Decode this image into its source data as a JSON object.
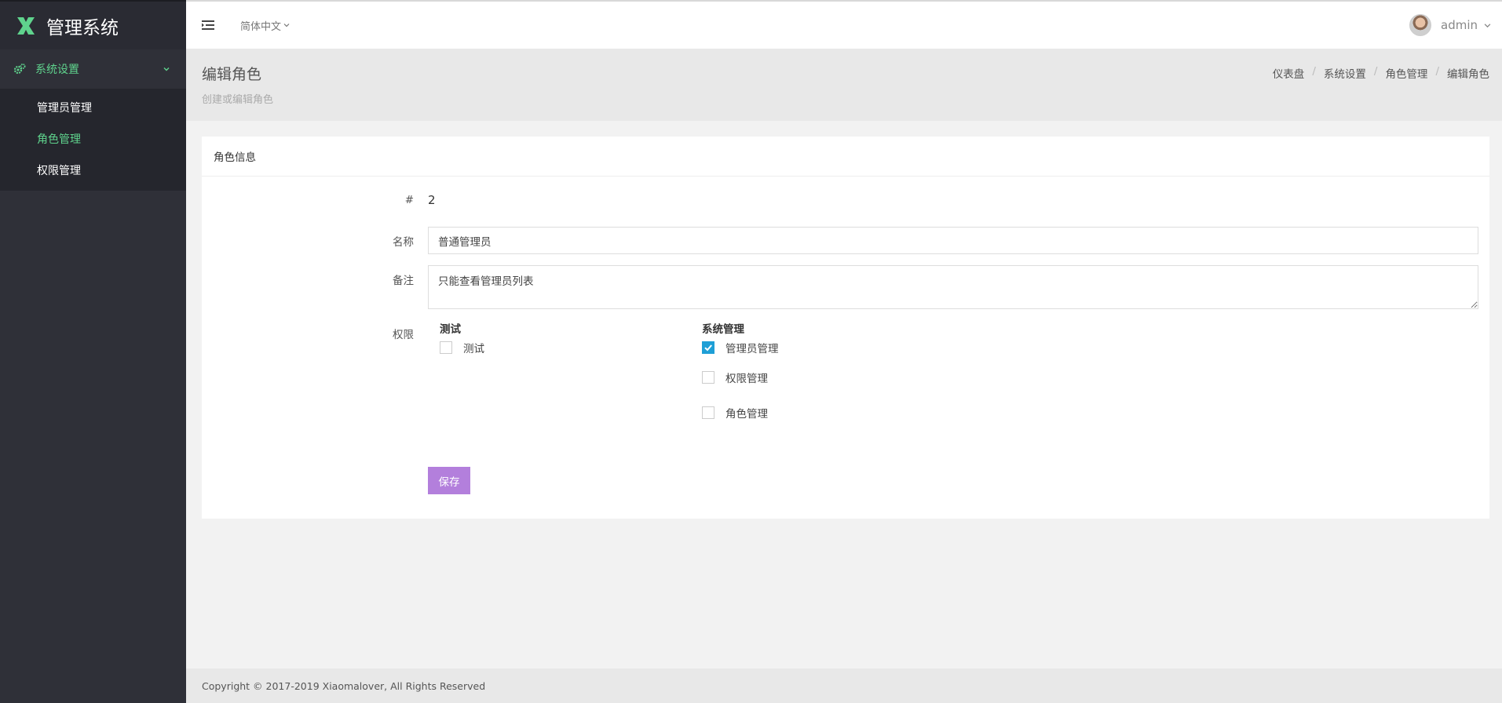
{
  "brand": {
    "title": "管理系统",
    "logo_color": "#5fd38d"
  },
  "sidebar": {
    "group_label": "系统设置",
    "items": [
      {
        "label": "管理员管理",
        "active": false
      },
      {
        "label": "角色管理",
        "active": true
      },
      {
        "label": "权限管理",
        "active": false
      }
    ]
  },
  "topbar": {
    "language": "简体中文",
    "username": "admin"
  },
  "page": {
    "title": "编辑角色",
    "subtitle": "创建或编辑角色",
    "breadcrumb": [
      "仪表盘",
      "系统设置",
      "角色管理",
      "编辑角色"
    ]
  },
  "card": {
    "title": "角色信息",
    "id_label": "#",
    "id_value": "2",
    "name_label": "名称",
    "name_value": "普通管理员",
    "remark_label": "备注",
    "remark_value": "只能查看管理员列表",
    "perm_label": "权限",
    "perm_groups": [
      {
        "title": "测试",
        "items": [
          {
            "label": "测试",
            "checked": false
          }
        ]
      },
      {
        "title": "系统管理",
        "items": [
          {
            "label": "管理员管理",
            "checked": true
          },
          {
            "label": "权限管理",
            "checked": false
          },
          {
            "label": "角色管理",
            "checked": false
          }
        ]
      }
    ],
    "save_label": "保存"
  },
  "footer": {
    "copyright": "Copyright © 2017-2019 Xiaomalover, All Rights Reserved"
  },
  "colors": {
    "accent_green": "#5fd38d",
    "checkbox_blue": "#1e9fd6",
    "save_purple": "#b37fdc",
    "sidebar_bg": "#2f3038"
  }
}
